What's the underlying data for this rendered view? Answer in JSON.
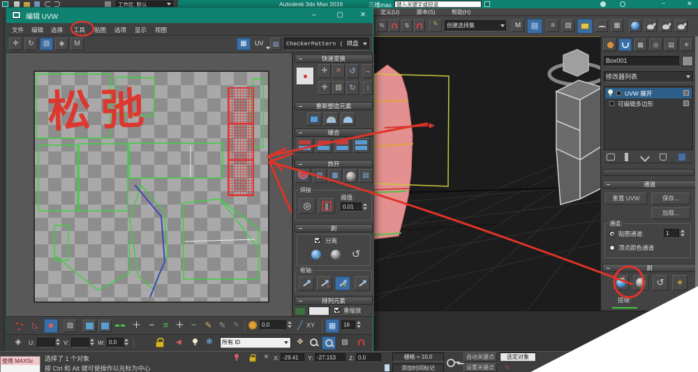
{
  "os_top": {
    "workspace": "工作区: 默认",
    "title": "Autodesk 3ds Max 2016",
    "subtitle": "三维max",
    "search": "键入关键字或短语"
  },
  "max_menu": {
    "items": [
      "定义(U)",
      "脚本(S)",
      "帮助(H)"
    ]
  },
  "main_toolbar": {
    "selection_set": "创建选择集"
  },
  "command_panel": {
    "object_name": "Box001",
    "modifier_list": "修改器列表",
    "stack": [
      {
        "label": "UVW 展开"
      },
      {
        "label": "可编辑多边形"
      }
    ],
    "channel": {
      "title": "通道",
      "reset": "重置 UVW",
      "save": "保存...",
      "load": "加载...",
      "group": "通道:",
      "map_channel": "贴图通道:",
      "map_channel_value": "1",
      "vertex_color": "顶点颜色通道"
    },
    "peel": {
      "title": "剥",
      "seams": "接缝:"
    }
  },
  "uvw": {
    "title": "编辑 UVW",
    "menus": [
      "文件",
      "编辑",
      "选择",
      "工具",
      "贴图",
      "选项",
      "显示",
      "视图"
    ],
    "uv_label": "UV",
    "pattern": "CheckerPattern   ( 棋盘",
    "rollouts": {
      "quick": "快速变换",
      "reshape": "重新塑造元素",
      "stitch": "缝合",
      "explode": "炸开",
      "weld": "焊接",
      "threshold_label": "阈值:",
      "threshold_value": "0.01",
      "peel": "剥",
      "separate": "分离",
      "pins": "框轴:",
      "arrange": "排列元素",
      "rescale": "重缩放"
    },
    "bottom": {
      "soft_value": "0.0",
      "xy": "XY",
      "map_size": "16",
      "u": "U:",
      "v": "V:",
      "w": "W:",
      "w_value": "0.0",
      "id_filter": "所有 ID"
    }
  },
  "status": {
    "listener": "使用 MAXSc",
    "line1": "选择了 1 个对象",
    "line2": "按 Ctrl 和 Alt 键可使操作以光标为中心",
    "x_label": "X:",
    "x": "-29.41",
    "y_label": "Y:",
    "y": "-27.153",
    "z_label": "Z:",
    "z": "0.0",
    "grid": "栅格 = 10.0",
    "add_time_tag": "添加时间标记",
    "auto_key": "自动关键点",
    "set_key": "设置关键点",
    "key_filter": "选定对象"
  },
  "annotations": {
    "handwriting": "松弛"
  },
  "icons": {
    "minimize": "–",
    "maximize": "▢",
    "close": "✕",
    "caretv": "∨",
    "move": "✛",
    "rotate": "↻",
    "undo": "↺",
    "plus": "＋",
    "minus": "−",
    "bars": "≡",
    "slash": "╱",
    "star": "★",
    "snowflake": "✻",
    "pencil": "✎",
    "grid": "▦",
    "rows": "▤",
    "shade": "▧",
    "diamond": "◈",
    "triangle": "◺",
    "pan": "✥",
    "target": "◎",
    "gear": "✳",
    "wave": "∿",
    "speaker": "◀",
    "mirror": "M",
    "square": "■",
    "verts": "∴",
    "xarrow": "→"
  }
}
